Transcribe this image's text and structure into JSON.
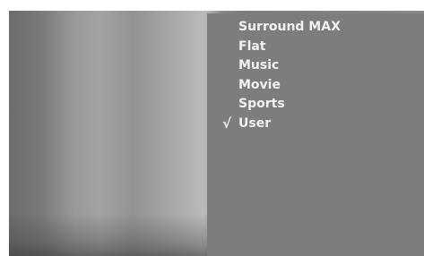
{
  "sound_mode_menu": {
    "items": [
      {
        "label": "Surround MAX",
        "selected": false
      },
      {
        "label": "Flat",
        "selected": false
      },
      {
        "label": "Music",
        "selected": false
      },
      {
        "label": "Movie",
        "selected": false
      },
      {
        "label": "Sports",
        "selected": false
      },
      {
        "label": "User",
        "selected": true
      }
    ],
    "check_mark": "√",
    "colors": {
      "panel": "#7d7d7d",
      "text": "#f1f1f1"
    }
  }
}
